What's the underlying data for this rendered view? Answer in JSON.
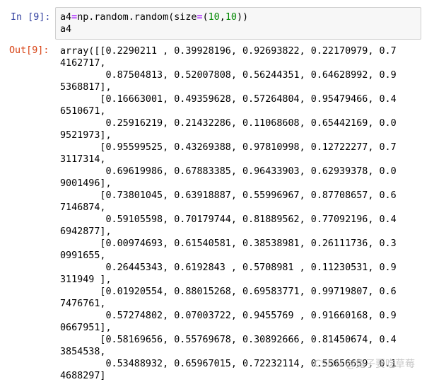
{
  "input_cell": {
    "prompt": "In [9]:",
    "line1": {
      "var": "a4",
      "op": "=",
      "call": "np.random.random",
      "open": "(",
      "kw": "size",
      "kwop": "=",
      "tuple_open": "(",
      "n1": "10",
      "comma": ",",
      "n2": "10",
      "close": "))"
    },
    "line2": "a4"
  },
  "output_cell": {
    "prompt": "Out[9]:",
    "lines": [
      "array([[0.2290211 , 0.39928196, 0.92693822, 0.22170979, 0.7",
      "4162717,",
      "        0.87504813, 0.52007808, 0.56244351, 0.64628992, 0.9",
      "5368817],",
      "       [0.16663001, 0.49359628, 0.57264804, 0.95479466, 0.4",
      "6510671,",
      "        0.25916219, 0.21432286, 0.11068608, 0.65442169, 0.0",
      "9521973],",
      "       [0.95599525, 0.43269388, 0.97810998, 0.12722277, 0.7",
      "3117314,",
      "        0.69619986, 0.67883385, 0.96433903, 0.62939378, 0.0",
      "9001496],",
      "       [0.73801045, 0.63918887, 0.55996967, 0.87708657, 0.6",
      "7146874,",
      "        0.59105598, 0.70179744, 0.81889562, 0.77092196, 0.4",
      "6942877],",
      "       [0.00974693, 0.61540581, 0.38538981, 0.26111736, 0.3",
      "0991655,",
      "        0.26445343, 0.6192843 , 0.5708981 , 0.11230531, 0.9",
      "311949 ],",
      "       [0.01920554, 0.88015268, 0.69583771, 0.99719807, 0.6",
      "7476761,",
      "        0.57274802, 0.07003722, 0.9455769 , 0.91660168, 0.9",
      "0667951],",
      "       [0.58169656, 0.55769678, 0.30892666, 0.81450674, 0.4",
      "3854538,",
      "        0.53488932, 0.65967015, 0.72232114, 0.55656659, 0.1",
      "4688297]"
    ]
  },
  "watermark": "CSDN @兔子要吃草莓",
  "colors": {
    "in_prompt": "#303f9f",
    "out_prompt": "#d84315",
    "input_bg": "#f7f7f7",
    "input_border": "#cfcfcf",
    "operator": "#aa22ff",
    "number": "#008800"
  }
}
